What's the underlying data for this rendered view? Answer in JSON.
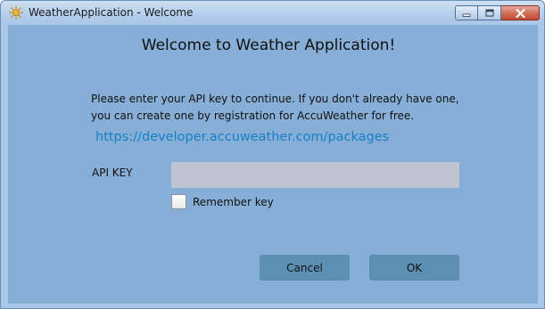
{
  "window": {
    "title": "WeatherApplication - Welcome",
    "icon": "sun-icon"
  },
  "dialog": {
    "heading": "Welcome to Weather Application!",
    "intro": "Please enter your API key to continue. If you don't already have one,\nyou can create one by registration for AccuWeather for free.",
    "link": "https://developer.accuweather.com/packages",
    "api_key_label": "API KEY",
    "api_key_value": "",
    "remember_label": "Remember key",
    "remember_checked": false,
    "cancel_label": "Cancel",
    "ok_label": "OK"
  },
  "colors": {
    "client_background": "#87aed6",
    "link": "#1680c6",
    "button": "#5d8fb3",
    "input": "#bfc4d2"
  }
}
